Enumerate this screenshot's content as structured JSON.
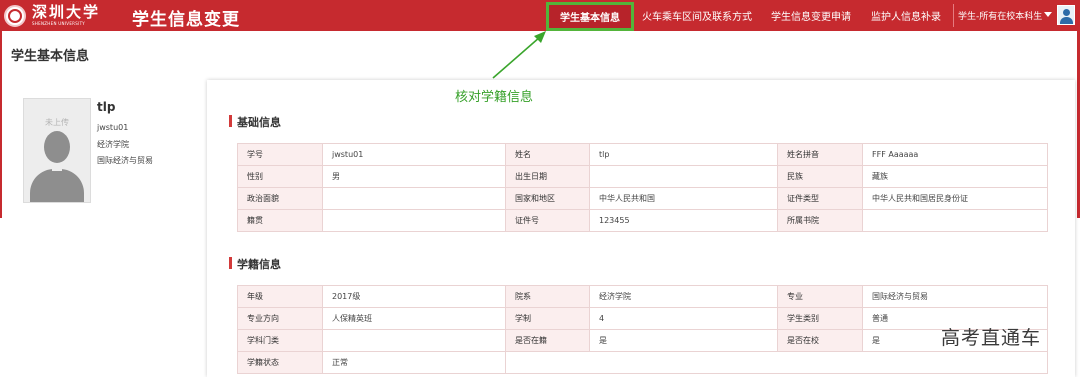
{
  "header": {
    "logo_text": "深圳大学",
    "logo_subtext": "SHENZHEN UNIVERSITY",
    "app_title": "学生信息变更",
    "nav": [
      "学生基本信息",
      "火车乘车区间及联系方式",
      "学生信息变更申请",
      "监护人信息补录"
    ],
    "role_label": "学生-所有在校本科生"
  },
  "page": {
    "title": "学生基本信息"
  },
  "profile": {
    "photo_placeholder": "未上传",
    "name": "tlp",
    "student_id": "jwstu01",
    "college": "经济学院",
    "major": "国际经济与贸易"
  },
  "annotation": {
    "text": "核对学籍信息"
  },
  "basic": {
    "title": "基础信息",
    "rows": [
      [
        {
          "k": "学号",
          "v": "jwstu01"
        },
        {
          "k": "姓名",
          "v": "tlp"
        },
        {
          "k": "姓名拼音",
          "v": "FFF Aaaaaa"
        }
      ],
      [
        {
          "k": "性别",
          "v": "男"
        },
        {
          "k": "出生日期",
          "v": ""
        },
        {
          "k": "民族",
          "v": "藏族"
        }
      ],
      [
        {
          "k": "政治面貌",
          "v": ""
        },
        {
          "k": "国家和地区",
          "v": "中华人民共和国"
        },
        {
          "k": "证件类型",
          "v": "中华人民共和国居民身份证"
        }
      ],
      [
        {
          "k": "籍贯",
          "v": ""
        },
        {
          "k": "证件号",
          "v": "123455"
        },
        {
          "k": "所属书院",
          "v": ""
        }
      ]
    ]
  },
  "status": {
    "title": "学籍信息",
    "rows": [
      [
        {
          "k": "年级",
          "v": "2017级"
        },
        {
          "k": "院系",
          "v": "经济学院"
        },
        {
          "k": "专业",
          "v": "国际经济与贸易"
        }
      ],
      [
        {
          "k": "专业方向",
          "v": "人保精英班"
        },
        {
          "k": "学制",
          "v": "4"
        },
        {
          "k": "学生类别",
          "v": "普通"
        }
      ],
      [
        {
          "k": "学科门类",
          "v": ""
        },
        {
          "k": "是否在籍",
          "v": "是"
        },
        {
          "k": "是否在校",
          "v": "是"
        }
      ],
      [
        {
          "k": "学籍状态",
          "v": "正常"
        }
      ]
    ]
  },
  "watermark": "高考直通车",
  "colors": {
    "header_red": "#c62a2f",
    "highlight_green": "#53b43a",
    "annotation_green": "#37a12a",
    "key_cell_bg": "#fbeeee"
  }
}
